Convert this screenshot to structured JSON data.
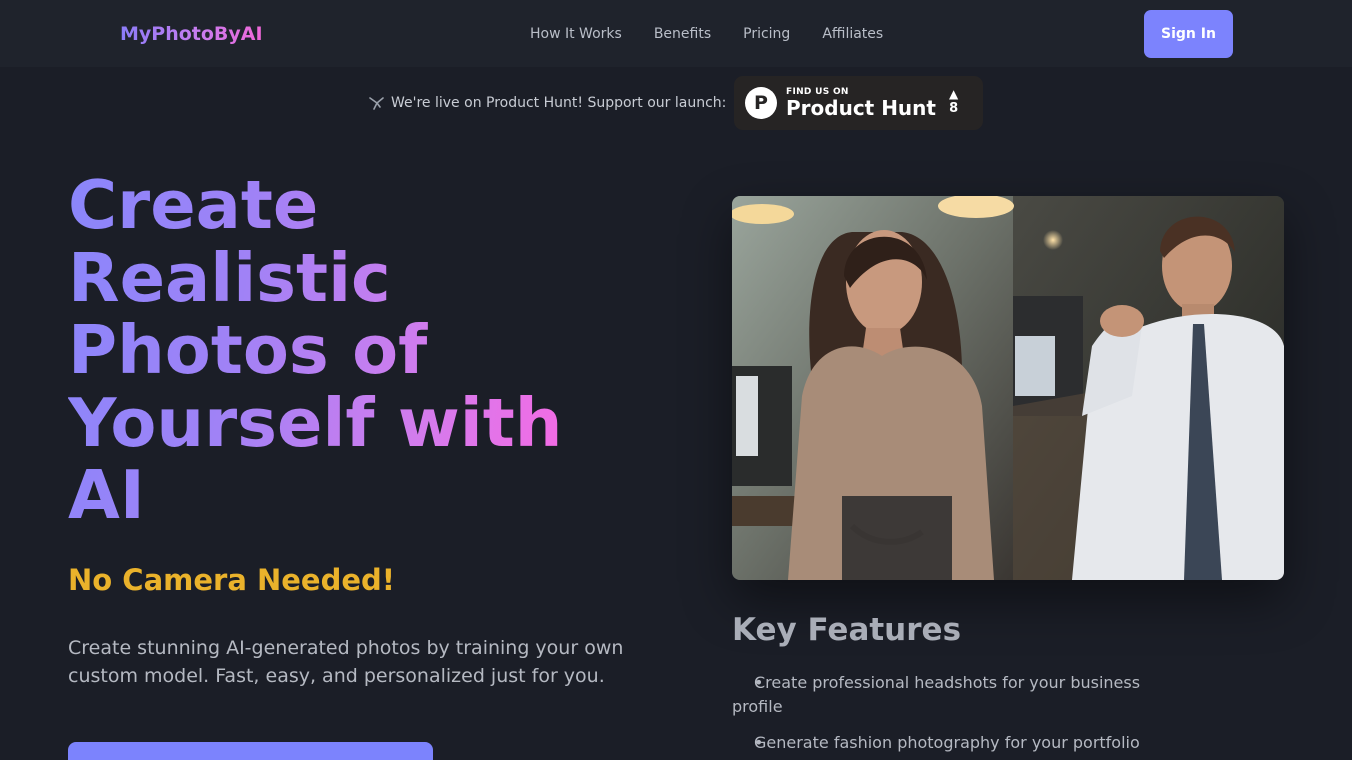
{
  "header": {
    "logo": "MyPhotoByAI",
    "nav": [
      {
        "label": "How It Works"
      },
      {
        "label": "Benefits"
      },
      {
        "label": "Pricing"
      },
      {
        "label": "Affiliates"
      }
    ],
    "signin_label": "Sign In"
  },
  "launch": {
    "text": "We're live on Product Hunt! Support our launch:",
    "icon": "bird-icon",
    "badge": {
      "small": "FIND US ON",
      "big": "Product Hunt",
      "logo_letter": "P",
      "arrow": "▲",
      "count": "8"
    }
  },
  "hero": {
    "title": "Create Realistic Photos of Yourself with AI",
    "tagline": "No Camera Needed!",
    "subtitle": "Create stunning AI-generated photos by training your own custom model. Fast, easy, and personalized just for you."
  },
  "features": {
    "title": "Key Features",
    "items": [
      "Create professional headshots for your business profile",
      "Generate fashion photography for your portfolio"
    ]
  },
  "colors": {
    "accent": "#7c83fd",
    "tagline": "#eab22b",
    "background": "#1b1e27"
  }
}
